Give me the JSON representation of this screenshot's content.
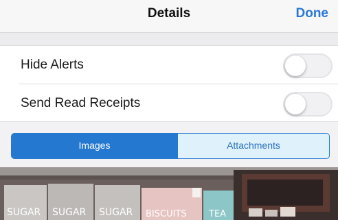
{
  "navbar": {
    "title": "Details",
    "done_label": "Done"
  },
  "settings": {
    "rows": [
      {
        "label": "Hide Alerts",
        "on": false
      },
      {
        "label": "Send Read Receipts",
        "on": false
      }
    ]
  },
  "segmented_control": {
    "options": [
      "Images",
      "Attachments"
    ],
    "selected": "Images"
  },
  "image_preview": {
    "labels": [
      "SUGAR",
      "SUGAR",
      "SUGAR",
      "BISCUITS",
      "TEA"
    ]
  },
  "colors": {
    "accent": "#2478d0",
    "done": "#2a79d6",
    "segment_unselected_bg": "#dff1fb"
  }
}
